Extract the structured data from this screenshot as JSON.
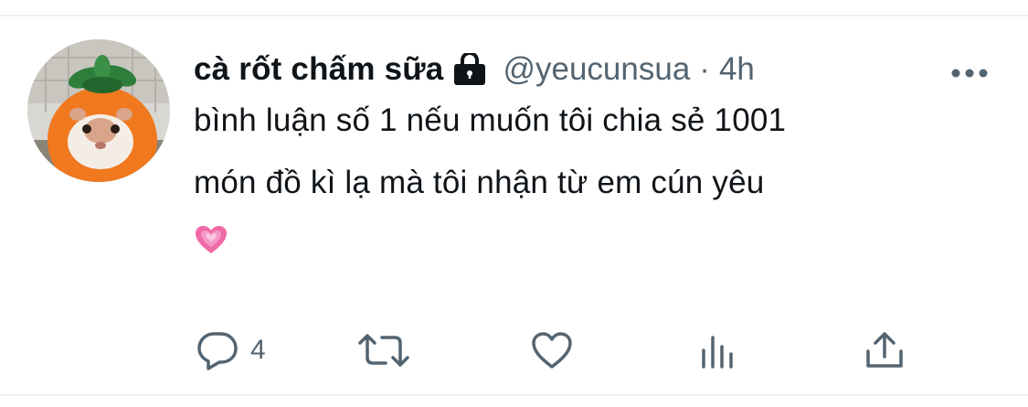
{
  "tweet": {
    "display_name": "cà rốt chấm sữa",
    "handle": "@yeucunsua",
    "separator": "·",
    "time": "4h",
    "text_line1": "bình luận số 1 nếu muốn tôi chia sẻ 1001",
    "text_line2": "món đồ kì lạ mà tôi nhận từ em cún yêu",
    "emoji": "growing-heart-emoji"
  },
  "actions": {
    "reply_count": "4"
  },
  "icons": {
    "lock": "lock-icon",
    "more": "more-horizontal-icon",
    "reply": "reply-icon",
    "retweet": "retweet-icon",
    "like": "heart-icon",
    "views": "analytics-icon",
    "share": "share-icon"
  },
  "colors": {
    "primary_text": "#0f1419",
    "secondary_text": "#536471",
    "divider": "#eff1f3",
    "heart_emoji": "#f06aa8"
  }
}
